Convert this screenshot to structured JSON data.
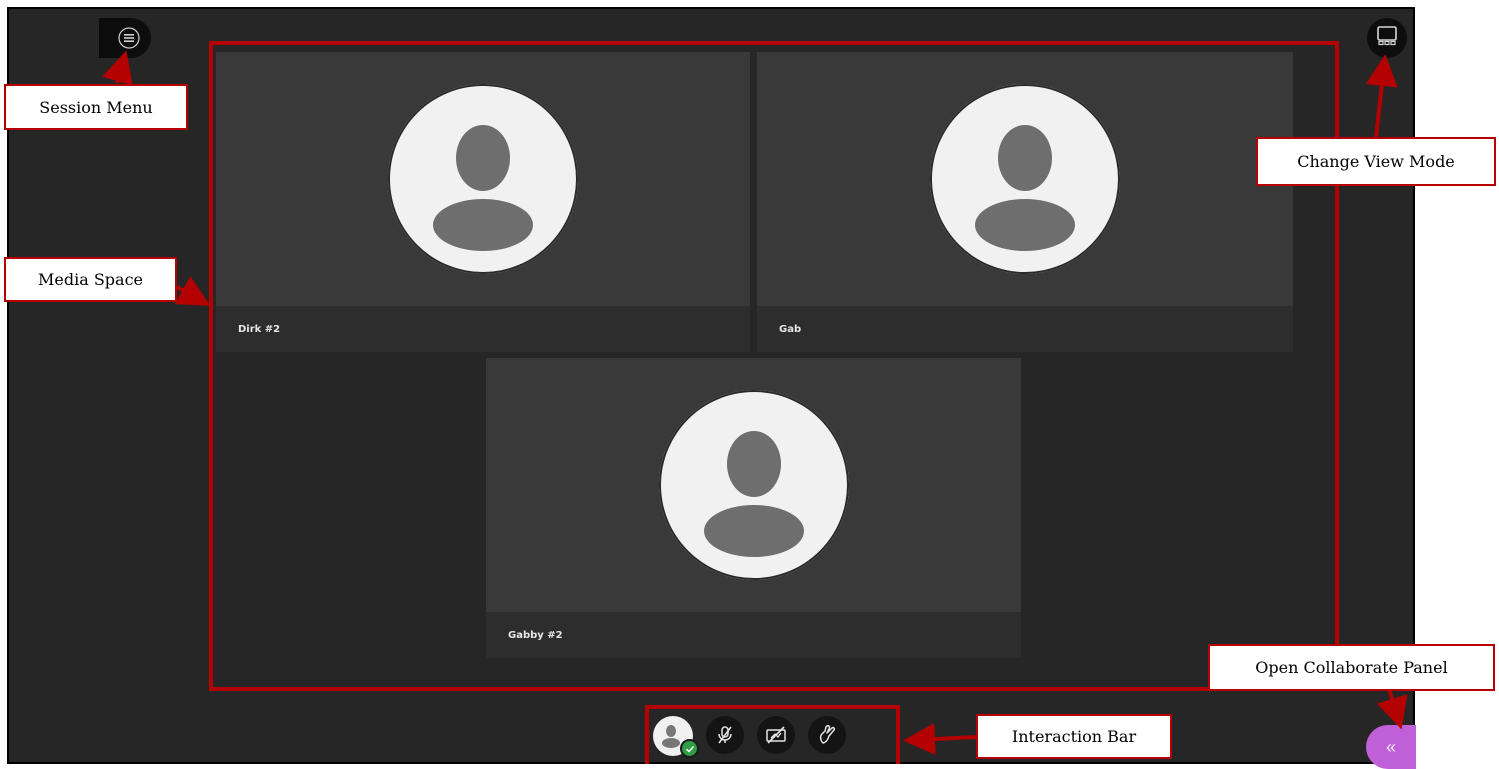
{
  "participants": [
    {
      "name": "Dirk #2"
    },
    {
      "name": "Gab"
    },
    {
      "name": "Gabby #2"
    }
  ],
  "callouts": {
    "session_menu": "Session Menu",
    "change_view_mode": "Change View Mode",
    "media_space": "Media Space",
    "open_collaborate_panel": "Open Collaborate Panel",
    "interaction_bar": "Interaction Bar"
  },
  "collaborate_panel_glyph": "«",
  "colors": {
    "highlight": "#b40000",
    "background": "#262626",
    "tile": "#393939",
    "collaborate_accent": "#c060d8",
    "status_green": "#2f9e44"
  },
  "icons": {
    "session_menu": "hamburger-icon",
    "view_mode": "view-mode-icon",
    "status": "my-status-icon",
    "mic": "microphone-muted-icon",
    "camera": "camera-off-icon",
    "hand": "raise-hand-icon",
    "collaborate": "double-chevron-left-icon"
  }
}
